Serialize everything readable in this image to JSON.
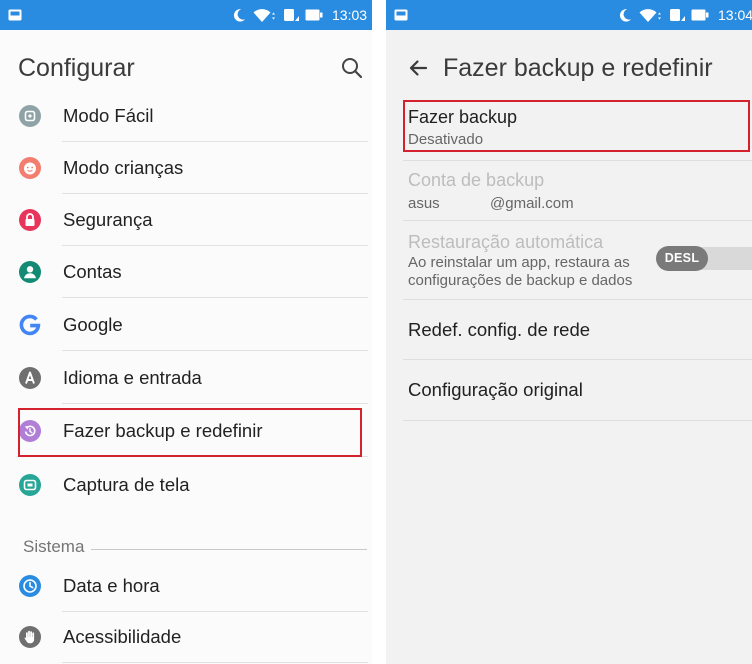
{
  "highlight_color": "#D3212D",
  "status_bar_color": "#2A8CE0",
  "status_bar_icons": [
    "image-notification-icon",
    "moon-icon",
    "wifi-icon",
    "data-icon",
    "battery-icon"
  ],
  "left_screen": {
    "status_bar": {
      "time": "13:03"
    },
    "title": "Configurar",
    "search_icon": "search-icon",
    "items": [
      {
        "label": "Modo Fácil",
        "icon": "easy-mode-icon",
        "color": "#8FA3A7"
      },
      {
        "label": "Modo crianças",
        "icon": "kids-mode-icon",
        "color": "#F37D6E"
      },
      {
        "label": "Segurança",
        "icon": "lock-icon",
        "color": "#E8355B"
      },
      {
        "label": "Contas",
        "icon": "account-icon",
        "color": "#138A74"
      },
      {
        "label": "Google",
        "icon": "google-g-icon",
        "color": "#4285F4"
      },
      {
        "label": "Idioma e entrada",
        "icon": "language-icon",
        "color": "#6F6F6F"
      },
      {
        "label": "Fazer backup e redefinir",
        "icon": "backup-restore-icon",
        "color": "#B07ED6",
        "highlighted": true
      },
      {
        "label": "Captura de tela",
        "icon": "screenshot-icon",
        "color": "#27A597"
      }
    ],
    "system_section": {
      "header": "Sistema",
      "items": [
        {
          "label": "Data e hora",
          "icon": "clock-icon",
          "color": "#2A8CE0"
        },
        {
          "label": "Acessibilidade",
          "icon": "accessibility-hand-icon",
          "color": "#6F6F6F"
        }
      ]
    }
  },
  "right_screen": {
    "status_bar": {
      "time": "13:04"
    },
    "back_icon": "back-arrow-icon",
    "title": "Fazer backup e redefinir",
    "items": [
      {
        "title": "Fazer backup",
        "summary": "Desativado",
        "enabled": true,
        "highlighted": true
      },
      {
        "title": "Conta de backup",
        "account_prefix": "asus",
        "account_domain": "@gmail.com",
        "enabled": false
      },
      {
        "title": "Restauração automática",
        "summary_line1": "Ao reinstalar um app, restaura as",
        "summary_line2": "configurações de backup e dados",
        "enabled": false,
        "toggle": {
          "label": "DESL",
          "on": false
        }
      },
      {
        "title": "Redef. config. de rede",
        "enabled": true
      },
      {
        "title": "Configuração original",
        "enabled": true
      }
    ]
  }
}
